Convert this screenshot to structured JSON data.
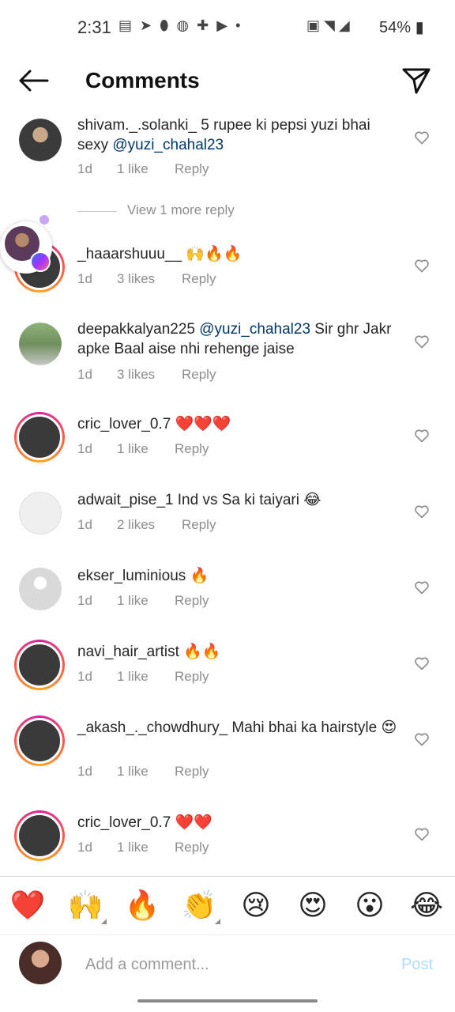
{
  "status_bar": {
    "time": "2:31",
    "left_icons": [
      "news-icon",
      "telegram-icon",
      "swiggy-icon",
      "app-icon",
      "add-contact-icon",
      "youtube-icon",
      "dot-icon"
    ],
    "right_icons": [
      "volte-icon",
      "wifi-icon",
      "signal-icon"
    ],
    "battery": "54%"
  },
  "header": {
    "title": "Comments"
  },
  "comments": [
    {
      "username": "shivam._.solanki_",
      "text": " 5 rupee ki pepsi yuzi bhai sexy ",
      "mention": "@yuzi_chahal23",
      "time": "1d",
      "likes": "1 like",
      "reply": "Reply",
      "view_replies": "View 1 more reply"
    },
    {
      "username": "_haaarshuuu__",
      "text": " 🙌🔥🔥",
      "time": "1d",
      "likes": "3 likes",
      "reply": "Reply"
    },
    {
      "username": "deepakkalyan225",
      "mention": "@yuzi_chahal23",
      "text": " Sir ghr Jakr apke Baal aise nhi rehenge jaise",
      "time": "1d",
      "likes": "3 likes",
      "reply": "Reply"
    },
    {
      "username": "cric_lover_0.7",
      "text": " ❤️❤️❤️",
      "time": "1d",
      "likes": "1 like",
      "reply": "Reply"
    },
    {
      "username": "adwait_pise_1",
      "text": " Ind vs Sa ki taiyari 😂",
      "time": "1d",
      "likes": "2 likes",
      "reply": "Reply"
    },
    {
      "username": "ekser_luminious",
      "text": " 🔥",
      "time": "1d",
      "likes": "1 like",
      "reply": "Reply"
    },
    {
      "username": "navi_hair_artist",
      "text": " 🔥🔥",
      "time": "1d",
      "likes": "1 like",
      "reply": "Reply"
    },
    {
      "username": "_akash_._chowdhury_",
      "text": " Mahi bhai ka hairstyle 😍",
      "time": "1d",
      "likes": "1 like",
      "reply": "Reply"
    },
    {
      "username": "cric_lover_0.7",
      "text": " ❤️❤️",
      "time": "1d",
      "likes": "1 like",
      "reply": "Reply"
    }
  ],
  "emoji_bar": [
    "❤️",
    "🙌",
    "🔥",
    "👏",
    "😢",
    "😍",
    "😮",
    "😂"
  ],
  "input": {
    "placeholder": "Add a comment...",
    "post_label": "Post"
  },
  "colors": {
    "mention": "#00376b",
    "meta": "#8e8e8e",
    "post_disabled": "#b3dbff"
  }
}
